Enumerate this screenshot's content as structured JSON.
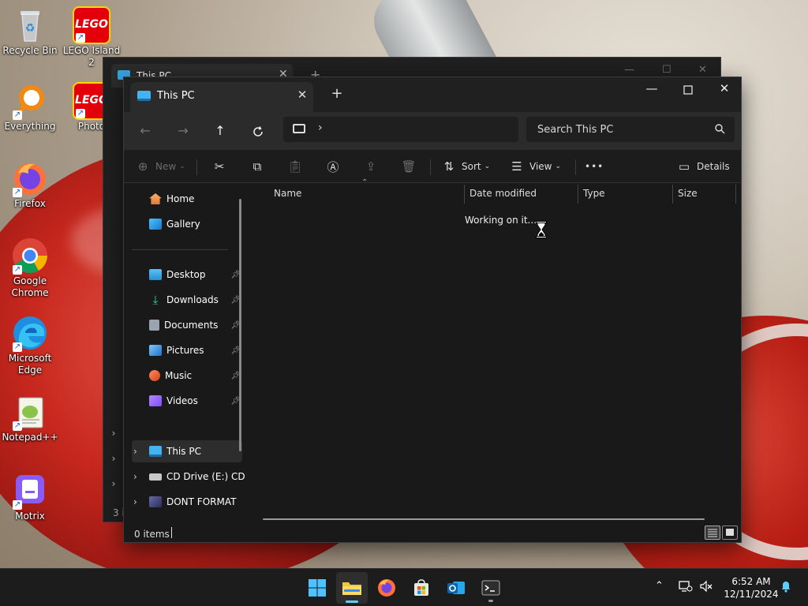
{
  "desktop": {
    "icons": [
      {
        "label": "Recycle Bin"
      },
      {
        "label": "LEGO Island 2"
      },
      {
        "label": "Everything"
      },
      {
        "label": "Photo"
      },
      {
        "label": "Firefox"
      },
      {
        "label": "Google Chrome"
      },
      {
        "label": "Microsoft Edge"
      },
      {
        "label": "Notepad++"
      },
      {
        "label": "Motrix"
      }
    ],
    "lego_text": "LEGO"
  },
  "ghost_window": {
    "tab_title": "This PC",
    "status": "3 i"
  },
  "explorer": {
    "tab_title": "This PC",
    "search_placeholder": "Search This PC",
    "toolbar": {
      "new_label": "New",
      "sort_label": "Sort",
      "view_label": "View",
      "more_label": "•••",
      "details_label": "Details"
    },
    "nav": {
      "home": "Home",
      "gallery": "Gallery",
      "desktop": "Desktop",
      "downloads": "Downloads",
      "documents": "Documents",
      "pictures": "Pictures",
      "music": "Music",
      "videos": "Videos",
      "this_pc": "This PC",
      "cd_drive": "CD Drive (E:) CD",
      "dont_format": "DONT FORMAT"
    },
    "columns": {
      "name": "Name",
      "date_modified": "Date modified",
      "type": "Type",
      "size": "Size"
    },
    "loading_text": "Working on it...",
    "status": "0 items"
  },
  "taskbar": {
    "time": "6:52 AM",
    "date": "12/11/2024"
  },
  "colors": {
    "accent": "#60cdff",
    "window_bg": "#191919",
    "toolbar_bg": "#2b2b2b"
  }
}
